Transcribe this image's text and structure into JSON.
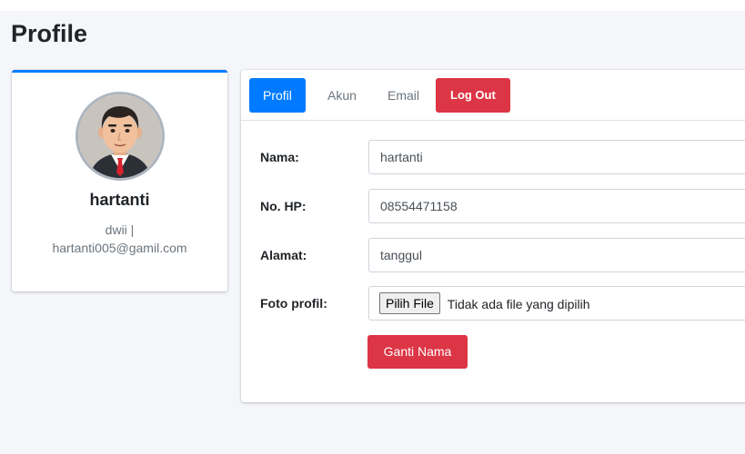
{
  "page": {
    "title": "Profile"
  },
  "profile_card": {
    "name": "hartanti",
    "username_line": "dwii |",
    "email": "hartanti005@gamil.com",
    "accent_color": "#007bff"
  },
  "tabs": [
    {
      "label": "Profil",
      "active": true
    },
    {
      "label": "Akun",
      "active": false
    },
    {
      "label": "Email",
      "active": false
    }
  ],
  "logout": {
    "label": "Log Out",
    "color": "#dc3545"
  },
  "form": {
    "nama_label": "Nama:",
    "nama_value": "hartanti",
    "hp_label": "No. HP:",
    "hp_value": "08554471158",
    "alamat_label": "Alamat:",
    "alamat_value": "tanggul",
    "foto_label": "Foto profil:",
    "file_button": "Pilih File",
    "file_status": "Tidak ada file yang dipilih",
    "submit_label": "Ganti Nama"
  },
  "icons": {
    "avatar": "male-avatar-icon"
  }
}
